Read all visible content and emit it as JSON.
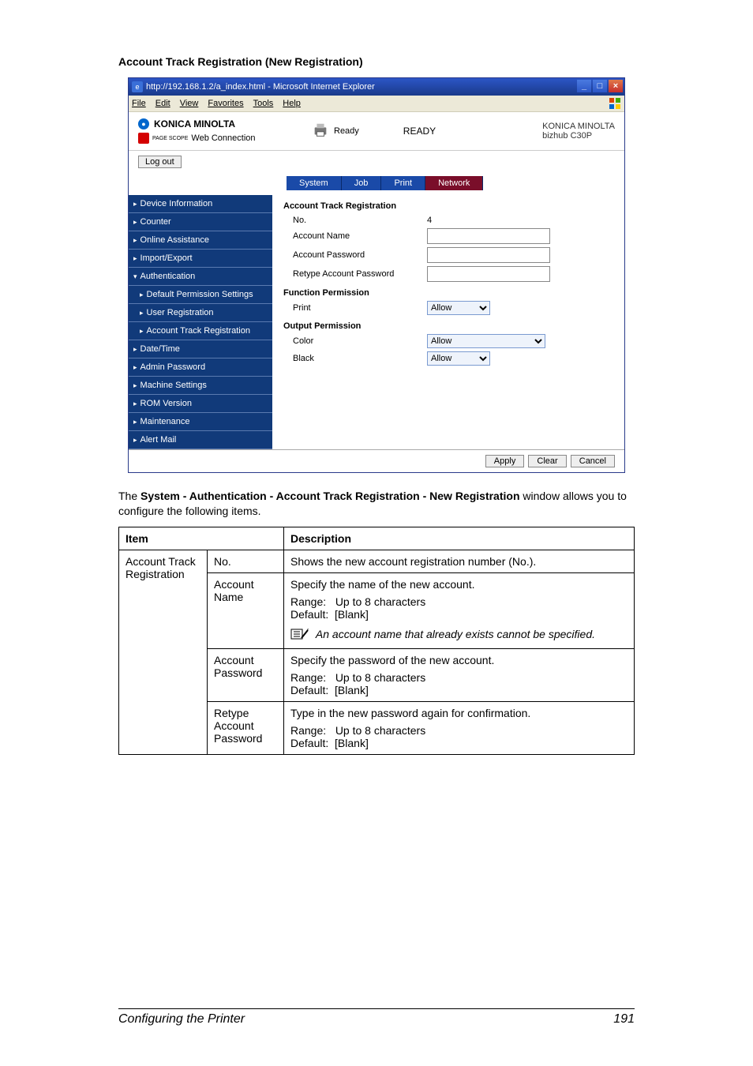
{
  "section_title": "Account Track Registration (New Registration)",
  "browser": {
    "title": "http://192.168.1.2/a_index.html - Microsoft Internet Explorer",
    "menu": [
      "File",
      "Edit",
      "View",
      "Favorites",
      "Tools",
      "Help"
    ],
    "brand": {
      "km": "KONICA MINOLTA",
      "pagescope": "Web Connection",
      "pagescope_prefix": "PAGE SCOPE"
    },
    "status": {
      "label": "Ready",
      "big": "READY"
    },
    "brand_right": {
      "l1": "KONICA MINOLTA",
      "l2": "bizhub C30P"
    },
    "logout": "Log out",
    "tabs": [
      "System",
      "Job",
      "Print",
      "Network"
    ],
    "sidebar": [
      {
        "label": "Device Information",
        "tri": "▸"
      },
      {
        "label": "Counter",
        "tri": "▸"
      },
      {
        "label": "Online Assistance",
        "tri": "▸"
      },
      {
        "label": "Import/Export",
        "tri": "▸"
      },
      {
        "label": "Authentication",
        "tri": "▾",
        "open": true
      },
      {
        "label": "Default Permission Settings",
        "tri": "▸",
        "sub": true
      },
      {
        "label": "User Registration",
        "tri": "▸",
        "sub": true
      },
      {
        "label": "Account Track Registration",
        "tri": "▸",
        "sub": true,
        "selected": true
      },
      {
        "label": "Date/Time",
        "tri": "▸"
      },
      {
        "label": "Admin Password",
        "tri": "▸"
      },
      {
        "label": "Machine Settings",
        "tri": "▸"
      },
      {
        "label": "ROM Version",
        "tri": "▸"
      },
      {
        "label": "Maintenance",
        "tri": "▸"
      },
      {
        "label": "Alert Mail",
        "tri": "▸"
      }
    ],
    "panel": {
      "title": "Account Track Registration",
      "rows": {
        "no_label": "No.",
        "no_value": "4",
        "acct_name": "Account Name",
        "acct_pw": "Account Password",
        "retype_pw": "Retype Account Password",
        "func_perm": "Function Permission",
        "print": "Print",
        "print_val": "Allow",
        "out_perm": "Output Permission",
        "color": "Color",
        "color_val": "Allow",
        "black": "Black",
        "black_val": "Allow"
      }
    },
    "buttons": {
      "apply": "Apply",
      "clear": "Clear",
      "cancel": "Cancel"
    }
  },
  "para": {
    "p1a": "The ",
    "p1b": "System - Authentication - Account Track Registration - New Registration",
    "p1c": " window allows you to configure the following items."
  },
  "table": {
    "hdr_item": "Item",
    "hdr_desc": "Description",
    "col1": "Account Track Registration",
    "r1": {
      "k": "No.",
      "d": "Shows the new account registration number (No.)."
    },
    "r2": {
      "k": "Account Name",
      "d1": "Specify the name of the new account.",
      "range": "Range:   Up to 8 characters",
      "def": "Default:  [Blank]",
      "note": "An account name that already exists cannot be specified."
    },
    "r3": {
      "k": "Account Password",
      "d1": "Specify the password of the new account.",
      "range": "Range:   Up to 8 characters",
      "def": "Default:  [Blank]"
    },
    "r4": {
      "k": "Retype Account Password",
      "d1": "Type in the new password again for confirmation.",
      "range": "Range:   Up to 8 characters",
      "def": "Default:  [Blank]"
    }
  },
  "footer": {
    "left": "Configuring the Printer",
    "right": "191"
  }
}
